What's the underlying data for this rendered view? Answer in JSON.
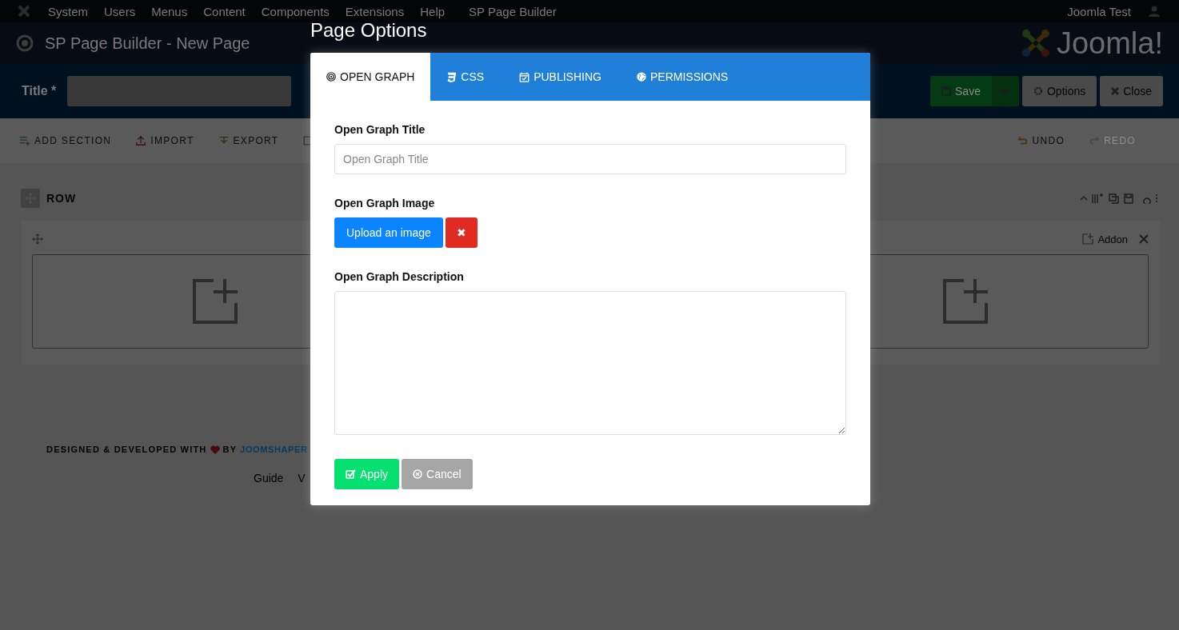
{
  "menu_bar": {
    "items": [
      "System",
      "Users",
      "Menus",
      "Content",
      "Components",
      "Extensions",
      "Help"
    ],
    "component": "SP Page Builder",
    "user_link": "Joomla Test"
  },
  "header": {
    "title": "SP Page Builder - New Page",
    "logo_text": "Joomla!"
  },
  "title_bar": {
    "label": "Title *",
    "save": "Save",
    "options": "Options",
    "close": "Close"
  },
  "toolbar": {
    "left": [
      {
        "kind": "add",
        "label": "ADD SECTION"
      },
      {
        "kind": "import",
        "label": "IMPORT"
      },
      {
        "kind": "export",
        "label": "EXPORT"
      },
      {
        "kind": "layout"
      }
    ],
    "right": [
      {
        "kind": "undo",
        "label": "UNDO",
        "disabled": false
      },
      {
        "kind": "redo",
        "label": "REDO",
        "disabled": true
      }
    ]
  },
  "row": {
    "label": "ROW",
    "addon": "Addon"
  },
  "footer": {
    "credit": "DESIGNED & DEVELOPED WITH",
    "by": "BY",
    "brand": "JOOMSHAPER",
    "links": [
      "Guide",
      "V"
    ]
  },
  "modal": {
    "title": "Page Options",
    "tabs": [
      {
        "kind": "target",
        "label": "OPEN GRAPH",
        "selected": true
      },
      {
        "kind": "css",
        "label": "CSS",
        "selected": false
      },
      {
        "kind": "calendar",
        "label": "PUBLISHING",
        "selected": false
      },
      {
        "kind": "globe",
        "label": "PERMISSIONS",
        "selected": false
      }
    ],
    "fields": {
      "title_label": "Open Graph Title",
      "title_placeholder": "Open Graph Title",
      "image_label": "Open Graph Image",
      "upload": "Upload an image",
      "remove": "✖",
      "description_label": "Open Graph Description"
    },
    "apply": "Apply",
    "cancel": "Cancel"
  }
}
